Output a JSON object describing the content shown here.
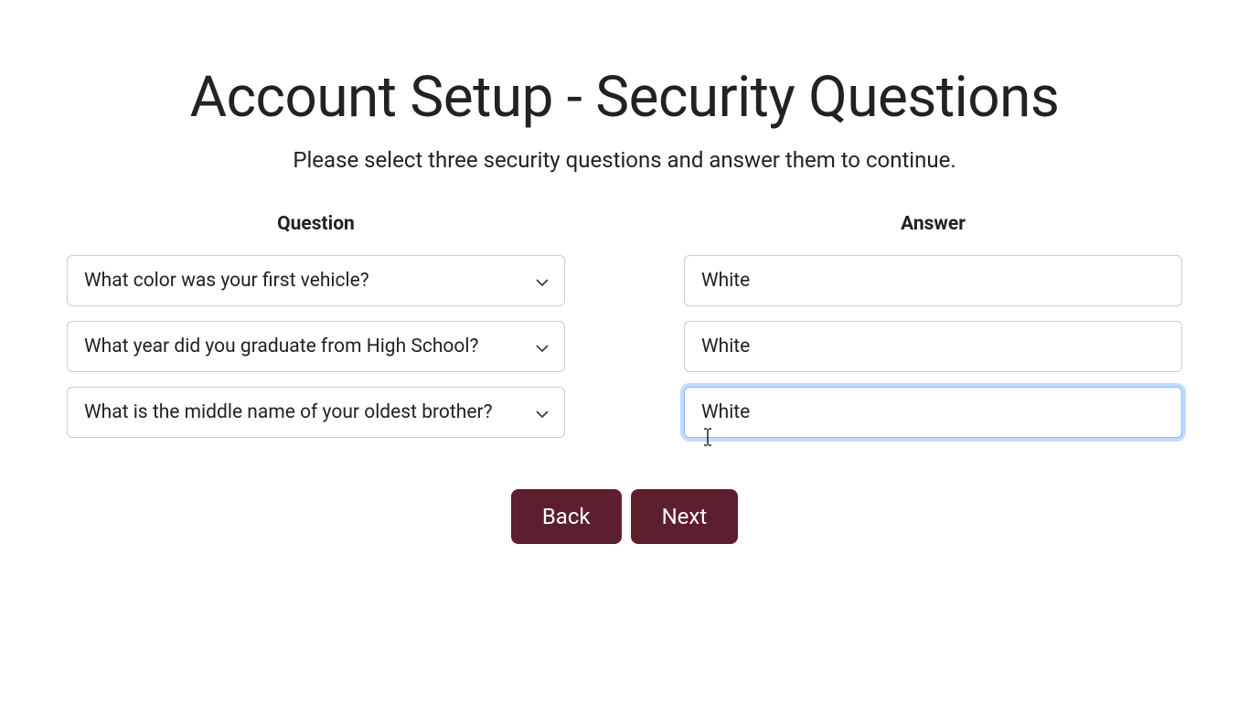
{
  "header": {
    "title": "Account Setup - Security Questions",
    "subtitle": "Please select three security questions and answer them to continue."
  },
  "columns": {
    "question_label": "Question",
    "answer_label": "Answer"
  },
  "rows": [
    {
      "question": "What color was your first vehicle?",
      "answer": "White"
    },
    {
      "question": "What year did you graduate from High School?",
      "answer": "White"
    },
    {
      "question": "What is the middle name of your oldest brother?",
      "answer": "White"
    }
  ],
  "buttons": {
    "back": "Back",
    "next": "Next"
  }
}
